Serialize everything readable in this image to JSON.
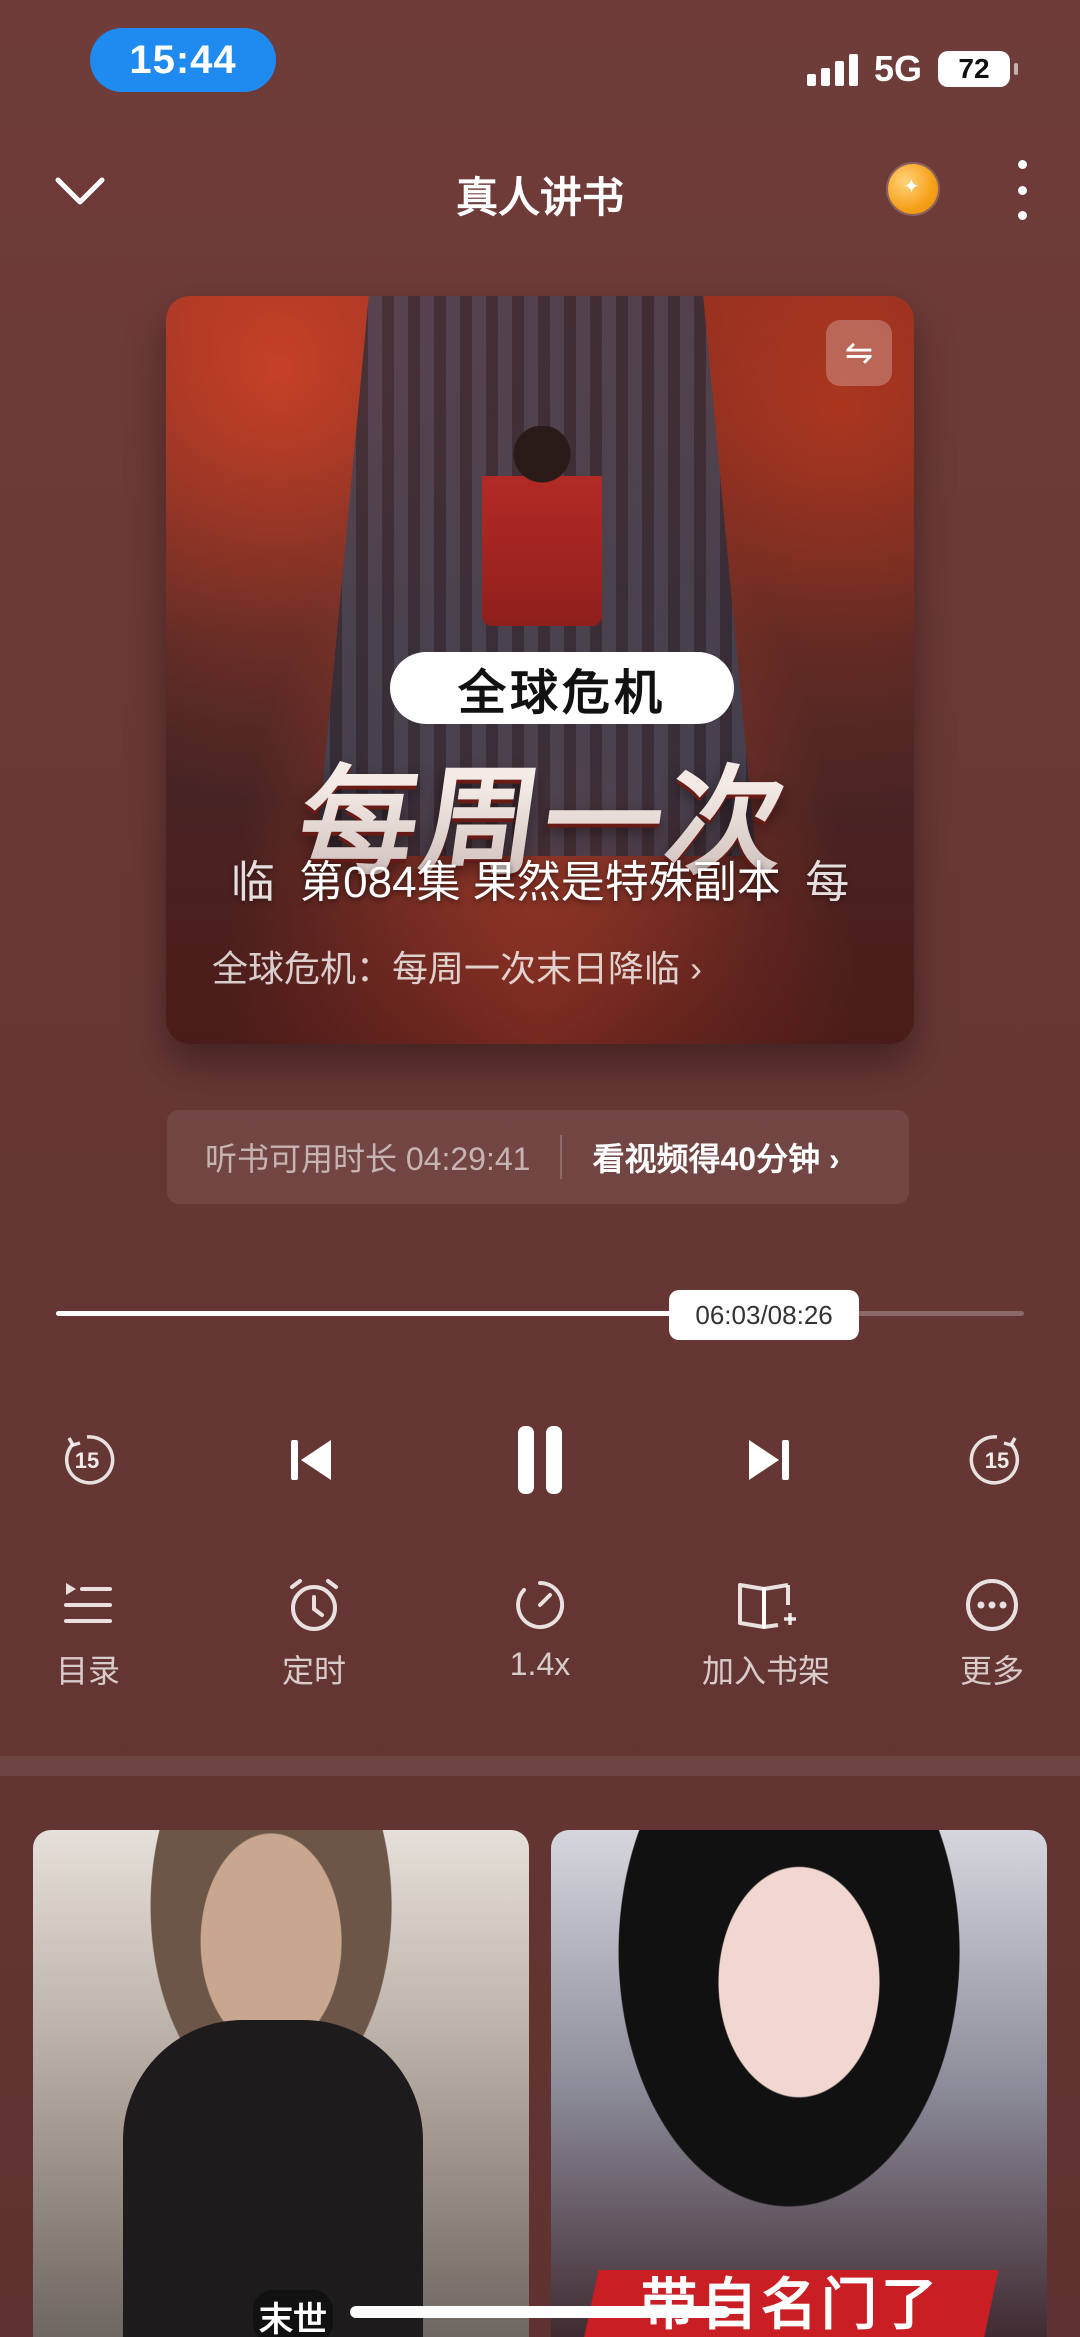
{
  "status_bar": {
    "time": "15:44",
    "network": "5G",
    "battery": "72"
  },
  "header": {
    "title": "真人讲书"
  },
  "cover": {
    "badge": "全球危机",
    "big_title": "每周一次",
    "episode_prev": "临",
    "episode_title": "第084集 果然是特殊副本",
    "episode_next": "每",
    "book_name": "全球危机：每周一次末日降临"
  },
  "listen_time": {
    "label": "听书可用时长 04:29:41",
    "reward": "看视频得40分钟 ›"
  },
  "progress": {
    "current": "06:03",
    "total": "08:26",
    "display": "06:03/08:26",
    "fraction": 0.716
  },
  "controls": {
    "rewind": "15",
    "forward": "15"
  },
  "toolbar": {
    "catalog": "目录",
    "timer": "定时",
    "speed": "1.4x",
    "add_shelf": "加入书架",
    "more": "更多"
  },
  "recommend": {
    "card1_tag": "末世",
    "card2_banner": "带自名门了"
  },
  "colors": {
    "background": "#6b3a37",
    "status_time_bg": "#1f8bf0",
    "coin": "#f6a11b"
  }
}
